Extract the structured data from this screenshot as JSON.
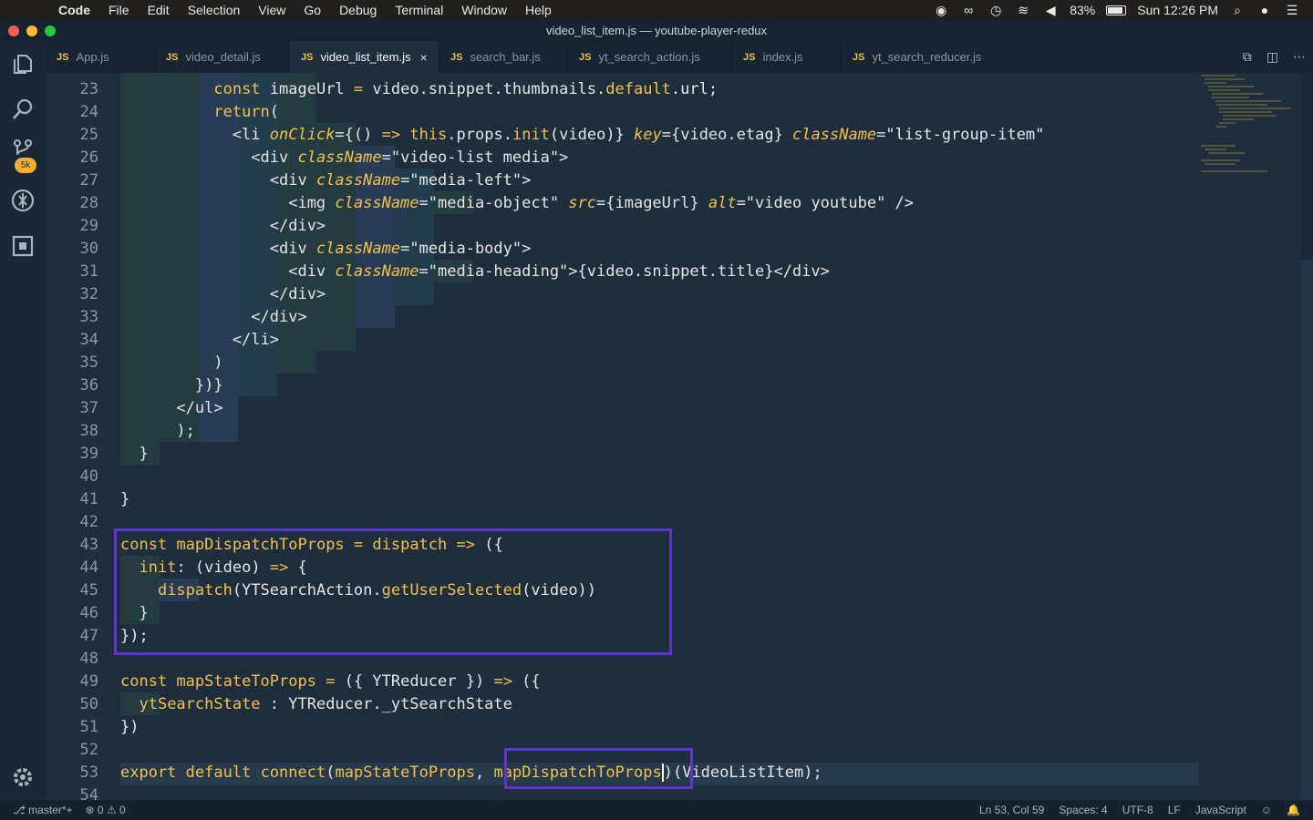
{
  "menubar": {
    "app": "Code",
    "items": [
      "File",
      "Edit",
      "Selection",
      "View",
      "Go",
      "Debug",
      "Terminal",
      "Window",
      "Help"
    ],
    "battery": "83%",
    "clock": "Sun 12:26 PM"
  },
  "window": {
    "title": "video_list_item.js — youtube-player-redux"
  },
  "activity": {
    "scm_badge": "5k"
  },
  "tabs": [
    {
      "label": "App.js",
      "active": false
    },
    {
      "label": "video_detail.js",
      "active": false
    },
    {
      "label": "video_list_item.js",
      "active": true
    },
    {
      "label": "search_bar.js",
      "active": false
    },
    {
      "label": "yt_search_action.js",
      "active": false
    },
    {
      "label": "index.js",
      "active": false
    },
    {
      "label": "yt_search_reducer.js",
      "active": false
    }
  ],
  "tab_icon_text": "JS",
  "tab_close_glyph": "×",
  "editor": {
    "lines": [
      {
        "n": "23",
        "code": "          const imageUrl = video.snippet.thumbnails.default.url;"
      },
      {
        "n": "24",
        "code": "          return("
      },
      {
        "n": "25",
        "code": "            <li onClick={() => this.props.init(video)} key={video.etag} className=\"list-group-item\""
      },
      {
        "n": "26",
        "code": "              <div className=\"video-list media\">"
      },
      {
        "n": "27",
        "code": "                <div className=\"media-left\">"
      },
      {
        "n": "28",
        "code": "                  <img className=\"media-object\" src={imageUrl} alt=\"video youtube\" />"
      },
      {
        "n": "29",
        "code": "                </div>"
      },
      {
        "n": "30",
        "code": "                <div className=\"media-body\">"
      },
      {
        "n": "31",
        "code": "                  <div className=\"media-heading\">{video.snippet.title}</div>"
      },
      {
        "n": "32",
        "code": "                </div>"
      },
      {
        "n": "33",
        "code": "              </div>"
      },
      {
        "n": "34",
        "code": "            </li>"
      },
      {
        "n": "35",
        "code": "          )"
      },
      {
        "n": "36",
        "code": "        })}"
      },
      {
        "n": "37",
        "code": "      </ul>"
      },
      {
        "n": "38",
        "code": "      );"
      },
      {
        "n": "39",
        "code": "  }"
      },
      {
        "n": "40",
        "code": ""
      },
      {
        "n": "41",
        "code": "}"
      },
      {
        "n": "42",
        "code": ""
      },
      {
        "n": "43",
        "code": "const mapDispatchToProps = dispatch => ({"
      },
      {
        "n": "44",
        "code": "  init: (video) => {"
      },
      {
        "n": "45",
        "code": "    dispatch(YTSearchAction.getUserSelected(video))"
      },
      {
        "n": "46",
        "code": "  }"
      },
      {
        "n": "47",
        "code": "});"
      },
      {
        "n": "48",
        "code": ""
      },
      {
        "n": "49",
        "code": "const mapStateToProps = ({ YTReducer }) => ({"
      },
      {
        "n": "50",
        "code": "  ytSearchState : YTReducer._ytSearchState"
      },
      {
        "n": "51",
        "code": "})"
      },
      {
        "n": "52",
        "code": ""
      },
      {
        "n": "53",
        "code": "export default connect(mapStateToProps, mapDispatchToProps)(VideoListItem);"
      },
      {
        "n": "54",
        "code": ""
      }
    ]
  },
  "statusbar": {
    "branch": "master*+",
    "errors": "0",
    "warnings": "0",
    "position": "Ln 53, Col 59",
    "spaces": "Spaces: 4",
    "encoding": "UTF-8",
    "eol": "LF",
    "language": "JavaScript"
  },
  "colors": {
    "editor_bg": "#1e2e3d",
    "keyword": "#f2c14a",
    "highlight_box": "#5b34d1"
  }
}
